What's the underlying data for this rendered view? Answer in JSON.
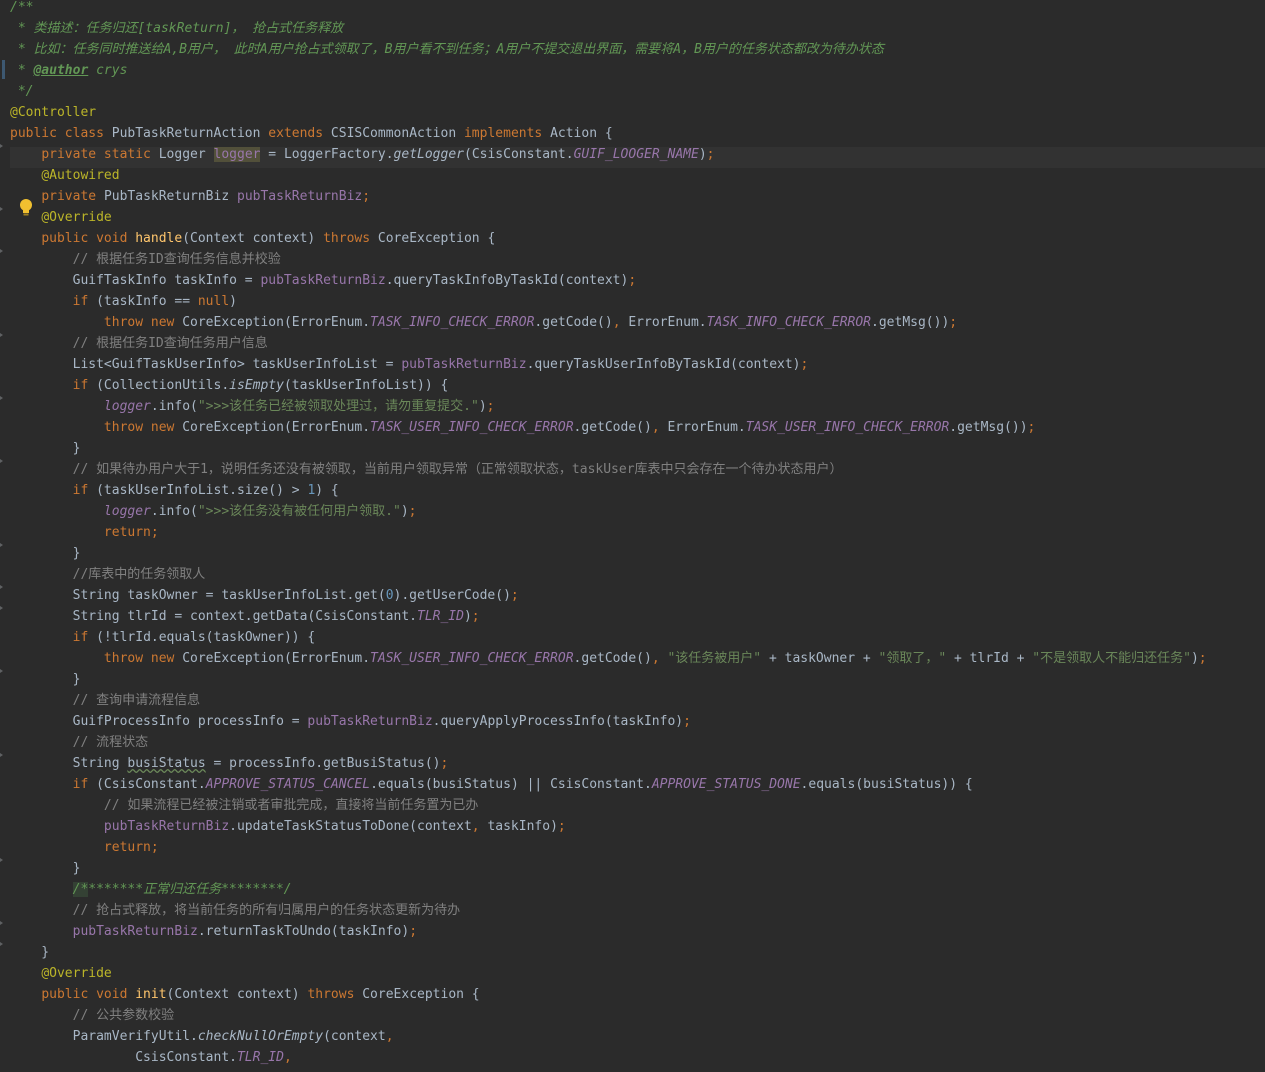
{
  "editor": {
    "lines": [
      {
        "segs": [
          [
            "doc",
            "/**"
          ]
        ]
      },
      {
        "segs": [
          [
            "doc",
            " * 类描述：任务归还[taskReturn]， 抢占式任务释放"
          ]
        ]
      },
      {
        "segs": [
          [
            "doc",
            " * 比如：任务同时推送给A,B用户， 此时A用户抢占式领取了，B用户看不到任务；A用户不提交退出界面，需要将A，B用户的任务状态都改为待办状态"
          ]
        ]
      },
      {
        "caret": true,
        "segs": [
          [
            "doc",
            " * "
          ],
          [
            "doctag",
            "@author"
          ],
          [
            "doc",
            " crys"
          ]
        ]
      },
      {
        "segs": [
          [
            "doc",
            " */"
          ]
        ]
      },
      {
        "segs": [
          [
            "ann",
            "@Controller"
          ]
        ]
      },
      {
        "segs": [
          [
            "kw",
            "public class "
          ],
          [
            "t",
            "PubTaskReturnAction "
          ],
          [
            "kw",
            "extends "
          ],
          [
            "t",
            "CSISCommonAction "
          ],
          [
            "kw",
            "implements "
          ],
          [
            "t",
            "Action {"
          ]
        ]
      },
      {
        "hl": true,
        "fold": true,
        "segs": [
          [
            "t",
            "    "
          ],
          [
            "kw",
            "private static "
          ],
          [
            "t",
            "Logger "
          ],
          [
            "fieldwarn",
            "logger"
          ],
          [
            "t",
            " = LoggerFactory."
          ],
          [
            "smeth",
            "getLogger"
          ],
          [
            "t",
            "(CsisConstant."
          ],
          [
            "static",
            "GUIF_LOOGER_NAME"
          ],
          [
            "t",
            ")"
          ],
          [
            "kw",
            ";"
          ]
        ]
      },
      {
        "segs": [
          [
            "t",
            "    "
          ],
          [
            "ann",
            "@Autowired"
          ]
        ]
      },
      {
        "segs": [
          [
            "t",
            "    "
          ],
          [
            "kw",
            "private "
          ],
          [
            "t",
            "PubTaskReturnBiz "
          ],
          [
            "field",
            "pubTaskReturnBiz"
          ],
          [
            "kw",
            ";"
          ]
        ]
      },
      {
        "fold": true,
        "segs": [
          [
            "t",
            "    "
          ],
          [
            "ann",
            "@Override"
          ]
        ]
      },
      {
        "segs": [
          [
            "t",
            "    "
          ],
          [
            "kw",
            "public void "
          ],
          [
            "method",
            "handle"
          ],
          [
            "t",
            "(Context context) "
          ],
          [
            "kw",
            "throws "
          ],
          [
            "t",
            "CoreException {"
          ]
        ]
      },
      {
        "fold": true,
        "segs": [
          [
            "comment",
            "        // 根据任务ID查询任务信息并校验"
          ]
        ]
      },
      {
        "segs": [
          [
            "t",
            "        GuifTaskInfo taskInfo = "
          ],
          [
            "field",
            "pubTaskReturnBiz"
          ],
          [
            "t",
            ".queryTaskInfoByTaskId(context)"
          ],
          [
            "kw",
            ";"
          ]
        ]
      },
      {
        "segs": [
          [
            "t",
            "        "
          ],
          [
            "kw",
            "if "
          ],
          [
            "t",
            "(taskInfo == "
          ],
          [
            "kw",
            "null"
          ],
          [
            "t",
            ")"
          ]
        ]
      },
      {
        "segs": [
          [
            "t",
            "            "
          ],
          [
            "kw",
            "throw new "
          ],
          [
            "t",
            "CoreException(ErrorEnum."
          ],
          [
            "static",
            "TASK_INFO_CHECK_ERROR"
          ],
          [
            "t",
            ".getCode()"
          ],
          [
            "kw",
            ", "
          ],
          [
            "t",
            "ErrorEnum."
          ],
          [
            "static",
            "TASK_INFO_CHECK_ERROR"
          ],
          [
            "t",
            ".getMsg())"
          ],
          [
            "kw",
            ";"
          ]
        ]
      },
      {
        "fold": true,
        "segs": [
          [
            "comment",
            "        // 根据任务ID查询任务用户信息"
          ]
        ]
      },
      {
        "segs": [
          [
            "t",
            "        List<GuifTaskUserInfo> taskUserInfoList = "
          ],
          [
            "field",
            "pubTaskReturnBiz"
          ],
          [
            "t",
            ".queryTaskUserInfoByTaskId(context)"
          ],
          [
            "kw",
            ";"
          ]
        ]
      },
      {
        "segs": [
          [
            "t",
            "        "
          ],
          [
            "kw",
            "if "
          ],
          [
            "t",
            "(CollectionUtils."
          ],
          [
            "smeth",
            "isEmpty"
          ],
          [
            "t",
            "(taskUserInfoList)) {"
          ]
        ]
      },
      {
        "fold": true,
        "segs": [
          [
            "t",
            "            "
          ],
          [
            "static",
            "logger"
          ],
          [
            "t",
            ".info("
          ],
          [
            "str",
            "\">>>该任务已经被领取处理过，请勿重复提交.\""
          ],
          [
            "t",
            ")"
          ],
          [
            "kw",
            ";"
          ]
        ]
      },
      {
        "segs": [
          [
            "t",
            "            "
          ],
          [
            "kw",
            "throw new "
          ],
          [
            "t",
            "CoreException(ErrorEnum."
          ],
          [
            "static",
            "TASK_USER_INFO_CHECK_ERROR"
          ],
          [
            "t",
            ".getCode()"
          ],
          [
            "kw",
            ", "
          ],
          [
            "t",
            "ErrorEnum."
          ],
          [
            "static",
            "TASK_USER_INFO_CHECK_ERROR"
          ],
          [
            "t",
            ".getMsg())"
          ],
          [
            "kw",
            ";"
          ]
        ]
      },
      {
        "segs": [
          [
            "t",
            "        }"
          ]
        ]
      },
      {
        "fold": true,
        "segs": [
          [
            "comment",
            "        // 如果待办用户大于1，说明任务还没有被领取，当前用户领取异常（正常领取状态，taskUser库表中只会存在一个待办状态用户）"
          ]
        ]
      },
      {
        "segs": [
          [
            "t",
            "        "
          ],
          [
            "kw",
            "if "
          ],
          [
            "t",
            "(taskUserInfoList.size() > "
          ],
          [
            "num",
            "1"
          ],
          [
            "t",
            ") {"
          ]
        ]
      },
      {
        "segs": [
          [
            "t",
            "            "
          ],
          [
            "static",
            "logger"
          ],
          [
            "t",
            ".info("
          ],
          [
            "str",
            "\">>>该任务没有被任何用户领取.\""
          ],
          [
            "t",
            ")"
          ],
          [
            "kw",
            ";"
          ]
        ]
      },
      {
        "segs": [
          [
            "t",
            "            "
          ],
          [
            "kw",
            "return;"
          ]
        ]
      },
      {
        "fold": true,
        "segs": [
          [
            "t",
            "        }"
          ]
        ]
      },
      {
        "segs": [
          [
            "comment",
            "        //库表中的任务领取人"
          ]
        ]
      },
      {
        "fold": true,
        "segs": [
          [
            "t",
            "        String taskOwner = taskUserInfoList.get("
          ],
          [
            "num",
            "0"
          ],
          [
            "t",
            ").getUserCode()"
          ],
          [
            "kw",
            ";"
          ]
        ]
      },
      {
        "fold": true,
        "segs": [
          [
            "t",
            "        String tlrId = context.getData(CsisConstant."
          ],
          [
            "static",
            "TLR_ID"
          ],
          [
            "t",
            ")"
          ],
          [
            "kw",
            ";"
          ]
        ]
      },
      {
        "segs": [
          [
            "t",
            "        "
          ],
          [
            "kw",
            "if "
          ],
          [
            "t",
            "(!tlrId.equals(taskOwner)) {"
          ]
        ]
      },
      {
        "segs": [
          [
            "t",
            "            "
          ],
          [
            "kw",
            "throw new "
          ],
          [
            "t",
            "CoreException(ErrorEnum."
          ],
          [
            "static",
            "TASK_USER_INFO_CHECK_ERROR"
          ],
          [
            "t",
            ".getCode()"
          ],
          [
            "kw",
            ", "
          ],
          [
            "str",
            "\"该任务被用户\""
          ],
          [
            "t",
            " + taskOwner + "
          ],
          [
            "str",
            "\"领取了，\""
          ],
          [
            "t",
            " + tlrId + "
          ],
          [
            "str",
            "\"不是领取人不能归还任务\""
          ],
          [
            "t",
            ")"
          ],
          [
            "kw",
            ";"
          ]
        ]
      },
      {
        "fold": true,
        "segs": [
          [
            "t",
            "        }"
          ]
        ]
      },
      {
        "segs": [
          [
            "comment",
            "        // 查询申请流程信息"
          ]
        ]
      },
      {
        "segs": [
          [
            "t",
            "        GuifProcessInfo processInfo = "
          ],
          [
            "field",
            "pubTaskReturnBiz"
          ],
          [
            "t",
            ".queryApplyProcessInfo(taskInfo)"
          ],
          [
            "kw",
            ";"
          ]
        ]
      },
      {
        "segs": [
          [
            "comment",
            "        // 流程状态"
          ]
        ]
      },
      {
        "fold": true,
        "segs": [
          [
            "t",
            "        String "
          ],
          [
            "squiggle",
            "busiStatus"
          ],
          [
            "t",
            " = processInfo.getBusiStatus()"
          ],
          [
            "kw",
            ";"
          ]
        ]
      },
      {
        "segs": [
          [
            "t",
            "        "
          ],
          [
            "kw",
            "if "
          ],
          [
            "t",
            "(CsisConstant."
          ],
          [
            "static",
            "APPROVE_STATUS_CANCEL"
          ],
          [
            "t",
            ".equals(busiStatus) || CsisConstant."
          ],
          [
            "static",
            "APPROVE_STATUS_DONE"
          ],
          [
            "t",
            ".equals(busiStatus)) {"
          ]
        ]
      },
      {
        "segs": [
          [
            "comment",
            "            // 如果流程已经被注销或者审批完成，直接将当前任务置为已办"
          ]
        ]
      },
      {
        "segs": [
          [
            "t",
            "            "
          ],
          [
            "field",
            "pubTaskReturnBiz"
          ],
          [
            "t",
            ".updateTaskStatusToDone(context"
          ],
          [
            "kw",
            ", "
          ],
          [
            "t",
            "taskInfo)"
          ],
          [
            "kw",
            ";"
          ]
        ]
      },
      {
        "segs": [
          [
            "t",
            "            "
          ],
          [
            "kw",
            "return;"
          ]
        ]
      },
      {
        "fold": true,
        "segs": [
          [
            "t",
            "        }"
          ]
        ]
      },
      {
        "segs": [
          [
            "t",
            "        "
          ],
          [
            "docsel",
            "/*"
          ],
          [
            "doc",
            "*******正常归还任务********/"
          ]
        ]
      },
      {
        "segs": [
          [
            "comment",
            "        // 抢占式释放，将当前任务的所有归属用户的任务状态更新为待办"
          ]
        ]
      },
      {
        "fold": true,
        "segs": [
          [
            "t",
            "        "
          ],
          [
            "field",
            "pubTaskReturnBiz"
          ],
          [
            "t",
            ".returnTaskToUndo(taskInfo)"
          ],
          [
            "kw",
            ";"
          ]
        ]
      },
      {
        "fold": true,
        "segs": [
          [
            "t",
            "    }"
          ]
        ]
      },
      {
        "segs": [
          [
            "t",
            "    "
          ],
          [
            "ann",
            "@Override"
          ]
        ]
      },
      {
        "segs": [
          [
            "t",
            "    "
          ],
          [
            "kw",
            "public void "
          ],
          [
            "method",
            "init"
          ],
          [
            "t",
            "(Context context) "
          ],
          [
            "kw",
            "throws "
          ],
          [
            "t",
            "CoreException {"
          ]
        ]
      },
      {
        "segs": [
          [
            "comment",
            "        // 公共参数校验"
          ]
        ]
      },
      {
        "segs": [
          [
            "t",
            "        ParamVerifyUtil."
          ],
          [
            "smeth",
            "checkNullOrEmpty"
          ],
          [
            "t",
            "(context"
          ],
          [
            "kw",
            ","
          ]
        ]
      },
      {
        "segs": [
          [
            "t",
            "                CsisConstant."
          ],
          [
            "static",
            "TLR_ID"
          ],
          [
            "kw",
            ","
          ]
        ]
      }
    ]
  },
  "icons": {
    "bulb": "lightbulb-intention-icon"
  }
}
